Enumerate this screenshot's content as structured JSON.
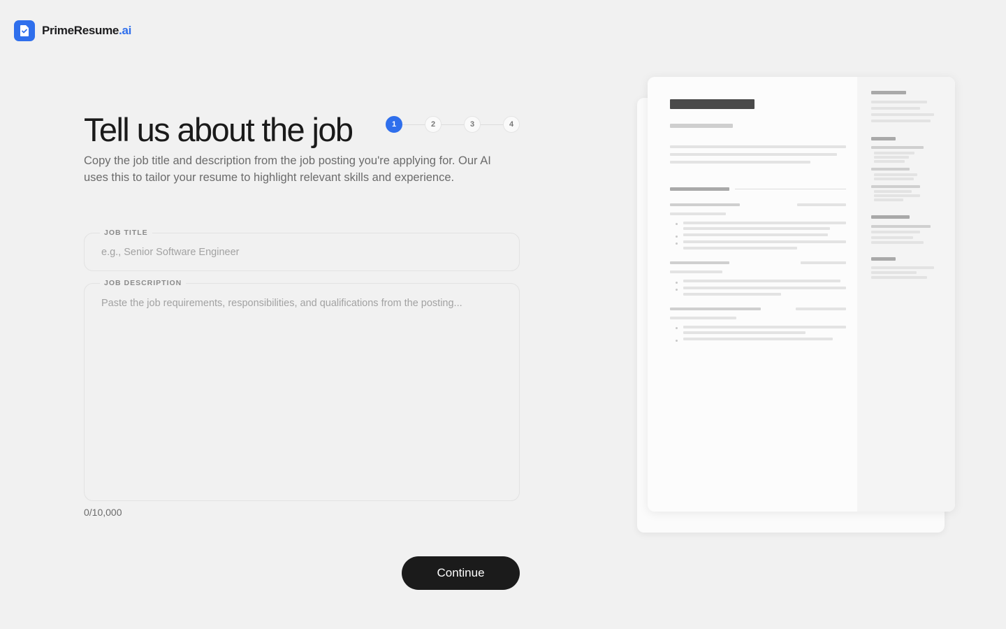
{
  "brand": {
    "name": "PrimeResume",
    "suffix": ".ai"
  },
  "page": {
    "title": "Tell us about the job",
    "subtitle": "Copy the job title and description from the job posting you're applying for. Our AI uses this to tailor your resume to highlight relevant skills and experience."
  },
  "stepper": {
    "steps": [
      "1",
      "2",
      "3",
      "4"
    ],
    "current": 1
  },
  "form": {
    "job_title": {
      "label": "JOB TITLE",
      "placeholder": "e.g., Senior Software Engineer",
      "value": ""
    },
    "job_description": {
      "label": "JOB DESCRIPTION",
      "placeholder": "Paste the job requirements, responsibilities, and qualifications from the posting...",
      "value": ""
    },
    "char_count": "0/10,000"
  },
  "actions": {
    "continue_label": "Continue"
  },
  "colors": {
    "accent": "#2f6fec",
    "button": "#1b1b1b",
    "background": "#f1f1f1"
  },
  "icons": {
    "logo": "document-check-icon"
  }
}
